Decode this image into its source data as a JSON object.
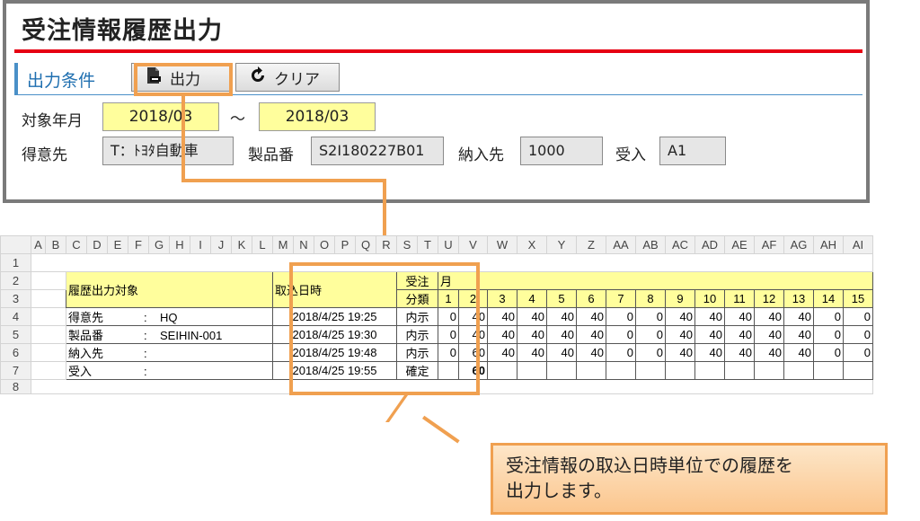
{
  "form": {
    "title": "受注情報履歴出力",
    "section_label": "出力条件",
    "output_button": "出力",
    "clear_button": "クリア",
    "target_month_label": "対象年月",
    "month_from": "2018/03",
    "range_sep": "～",
    "month_to": "2018/03",
    "customer_label": "得意先",
    "customer_value": "T：ﾄﾖﾀ自動車",
    "product_label": "製品番",
    "product_value": "S2I180227B01",
    "delivery_label": "納入先",
    "delivery_value": "1000",
    "receive_label": "受入",
    "receive_value": "A1"
  },
  "sheet": {
    "columns": [
      "A",
      "B",
      "C",
      "D",
      "E",
      "F",
      "G",
      "H",
      "I",
      "J",
      "K",
      "L",
      "M",
      "N",
      "O",
      "P",
      "Q",
      "R",
      "S",
      "T",
      "U",
      "V",
      "W",
      "X",
      "Y",
      "Z",
      "AA",
      "AB",
      "AC",
      "AD",
      "AE",
      "AF",
      "AG",
      "AH",
      "AI"
    ],
    "header": {
      "target": "履歴出力対象",
      "import_dt": "取込日時",
      "type_1": "受注",
      "type_2": "分類",
      "month_suffix": "月",
      "days": [
        "1",
        "2",
        "3",
        "4",
        "5",
        "6",
        "7",
        "8",
        "9",
        "10",
        "11",
        "12",
        "13",
        "14",
        "15"
      ]
    },
    "rows": [
      {
        "key": "得意先",
        "sep": ":",
        "val": "HQ",
        "dt": "2018/4/25 19:25",
        "type": "内示",
        "days": [
          "0",
          "40",
          "40",
          "40",
          "40",
          "40",
          "0",
          "0",
          "40",
          "40",
          "40",
          "40",
          "40",
          "0",
          "0"
        ]
      },
      {
        "key": "製品番",
        "sep": ":",
        "val": "SEIHIN-001",
        "dt": "2018/4/25 19:30",
        "type": "内示",
        "days": [
          "0",
          "40",
          "40",
          "40",
          "40",
          "40",
          "0",
          "0",
          "40",
          "40",
          "40",
          "40",
          "40",
          "0",
          "0"
        ]
      },
      {
        "key": "納入先",
        "sep": ":",
        "val": "",
        "dt": "2018/4/25 19:48",
        "type": "内示",
        "days": [
          "0",
          "60",
          "40",
          "40",
          "40",
          "40",
          "0",
          "0",
          "40",
          "40",
          "40",
          "40",
          "40",
          "0",
          "0"
        ]
      },
      {
        "key": "受入",
        "sep": ":",
        "val": "",
        "dt": "2018/4/25 19:55",
        "type": "確定",
        "days": [
          "",
          "60",
          "",
          "",
          "",
          "",
          "",
          "",
          "",
          "",
          "",
          "",
          "",
          "",
          ""
        ]
      }
    ],
    "row_numbers": [
      "1",
      "2",
      "3",
      "4",
      "5",
      "6",
      "7",
      "8"
    ]
  },
  "callout": {
    "line1": "受注情報の取込日時単位での履歴を",
    "line2": "出力します。"
  },
  "colors": {
    "accent_orange": "#f0a050",
    "title_red": "#e60012",
    "field_yellow": "#fffe9c",
    "section_blue": "#1f6fb0"
  }
}
